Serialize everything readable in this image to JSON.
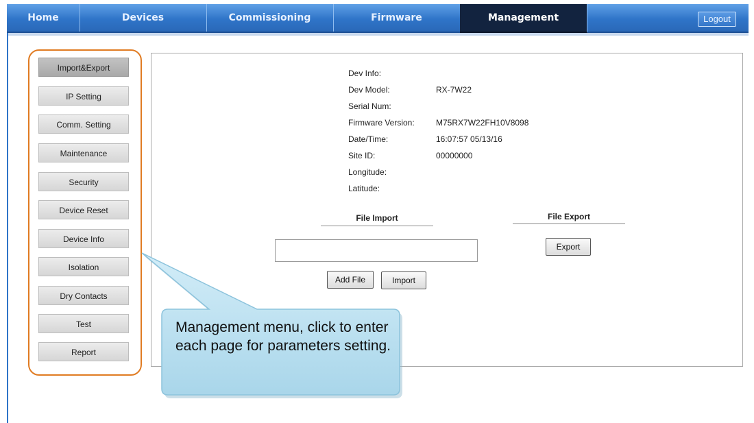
{
  "nav": {
    "tabs": [
      "Home",
      "Devices",
      "Commissioning",
      "Firmware",
      "Management"
    ],
    "active": "Management",
    "logout_label": "Logout"
  },
  "sidebar": {
    "items": [
      {
        "label": "Import&Export",
        "active": true
      },
      {
        "label": "IP Setting"
      },
      {
        "label": "Comm. Setting"
      },
      {
        "label": "Maintenance"
      },
      {
        "label": "Security"
      },
      {
        "label": "Device Reset"
      },
      {
        "label": "Device Info"
      },
      {
        "label": "Isolation"
      },
      {
        "label": "Dry Contacts"
      },
      {
        "label": "Test"
      },
      {
        "label": "Report"
      }
    ]
  },
  "dev_info": {
    "heading": "Dev Info:",
    "model_label": "Dev Model:",
    "model_value": "RX-7W22",
    "serial_label": "Serial Num:",
    "serial_value": "",
    "firmware_label": "Firmware Version:",
    "firmware_value": "M75RX7W22FH10V8098",
    "datetime_label": "Date/Time:",
    "datetime_value": "16:07:57 05/13/16",
    "site_label": "Site ID:",
    "site_value": "00000000",
    "longitude_label": "Longitude:",
    "longitude_value": "",
    "latitude_label": "Latitude:",
    "latitude_value": ""
  },
  "file_import": {
    "title": "File Import",
    "input_value": "",
    "add_file_label": "Add File",
    "import_label": "Import"
  },
  "file_export": {
    "title": "File Export",
    "export_label": "Export"
  },
  "callout": {
    "text": "Management menu, click to enter each page for parameters setting."
  },
  "colors": {
    "nav_blue": "#2f74c8",
    "nav_active": "#12233f",
    "outline_orange": "#e07b22",
    "callout_fill": "#bfe3f2"
  }
}
